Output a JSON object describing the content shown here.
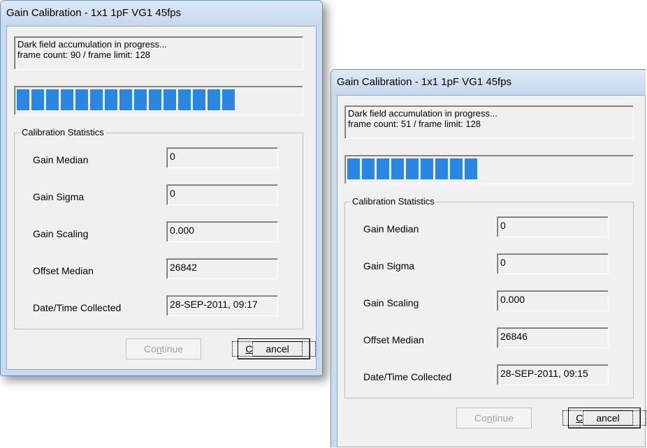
{
  "dialogs": [
    {
      "title": "Gain Calibration - 1x1 1pF VG1 45fps",
      "status_line1": "Dark field accumulation in progress...",
      "status_line2": "frame count: 90 / frame limit: 128",
      "progress": 0.703,
      "progress_segments_filled": 15,
      "group_title": "Calibration Statistics",
      "stats": [
        {
          "label": "Gain Median",
          "value": "0"
        },
        {
          "label": "Gain Sigma",
          "value": "0"
        },
        {
          "label": "Gain Scaling",
          "value": "0.000"
        },
        {
          "label": "Offset Median",
          "value": "26842"
        },
        {
          "label": "Date/Time Collected",
          "value": "28-SEP-2011, 09:17"
        }
      ],
      "continue_label_pre": "Co",
      "continue_label_ul": "n",
      "continue_label_post": "tinue",
      "cancel_label_ul": "C",
      "cancel_label_post": "ancel",
      "continue_enabled": false
    },
    {
      "title": "Gain Calibration - 1x1 1pF VG1 45fps",
      "status_line1": "Dark field accumulation in progress...",
      "status_line2": "frame count: 51 / frame limit: 128",
      "progress": 0.398,
      "progress_segments_filled": 9,
      "group_title": "Calibration Statistics",
      "stats": [
        {
          "label": "Gain Median",
          "value": "0"
        },
        {
          "label": "Gain Sigma",
          "value": "0"
        },
        {
          "label": "Gain Scaling",
          "value": "0.000"
        },
        {
          "label": "Offset Median",
          "value": "26846"
        },
        {
          "label": "Date/Time Collected",
          "value": "28-SEP-2011, 09:15"
        }
      ],
      "continue_label_pre": "Co",
      "continue_label_ul": "n",
      "continue_label_post": "tinue",
      "cancel_label_ul": "C",
      "cancel_label_post": "ancel",
      "continue_enabled": false
    }
  ],
  "colors": {
    "progress_fill": "#2a86e3",
    "frame": "#c8daee",
    "client": "#f0f0f0"
  }
}
